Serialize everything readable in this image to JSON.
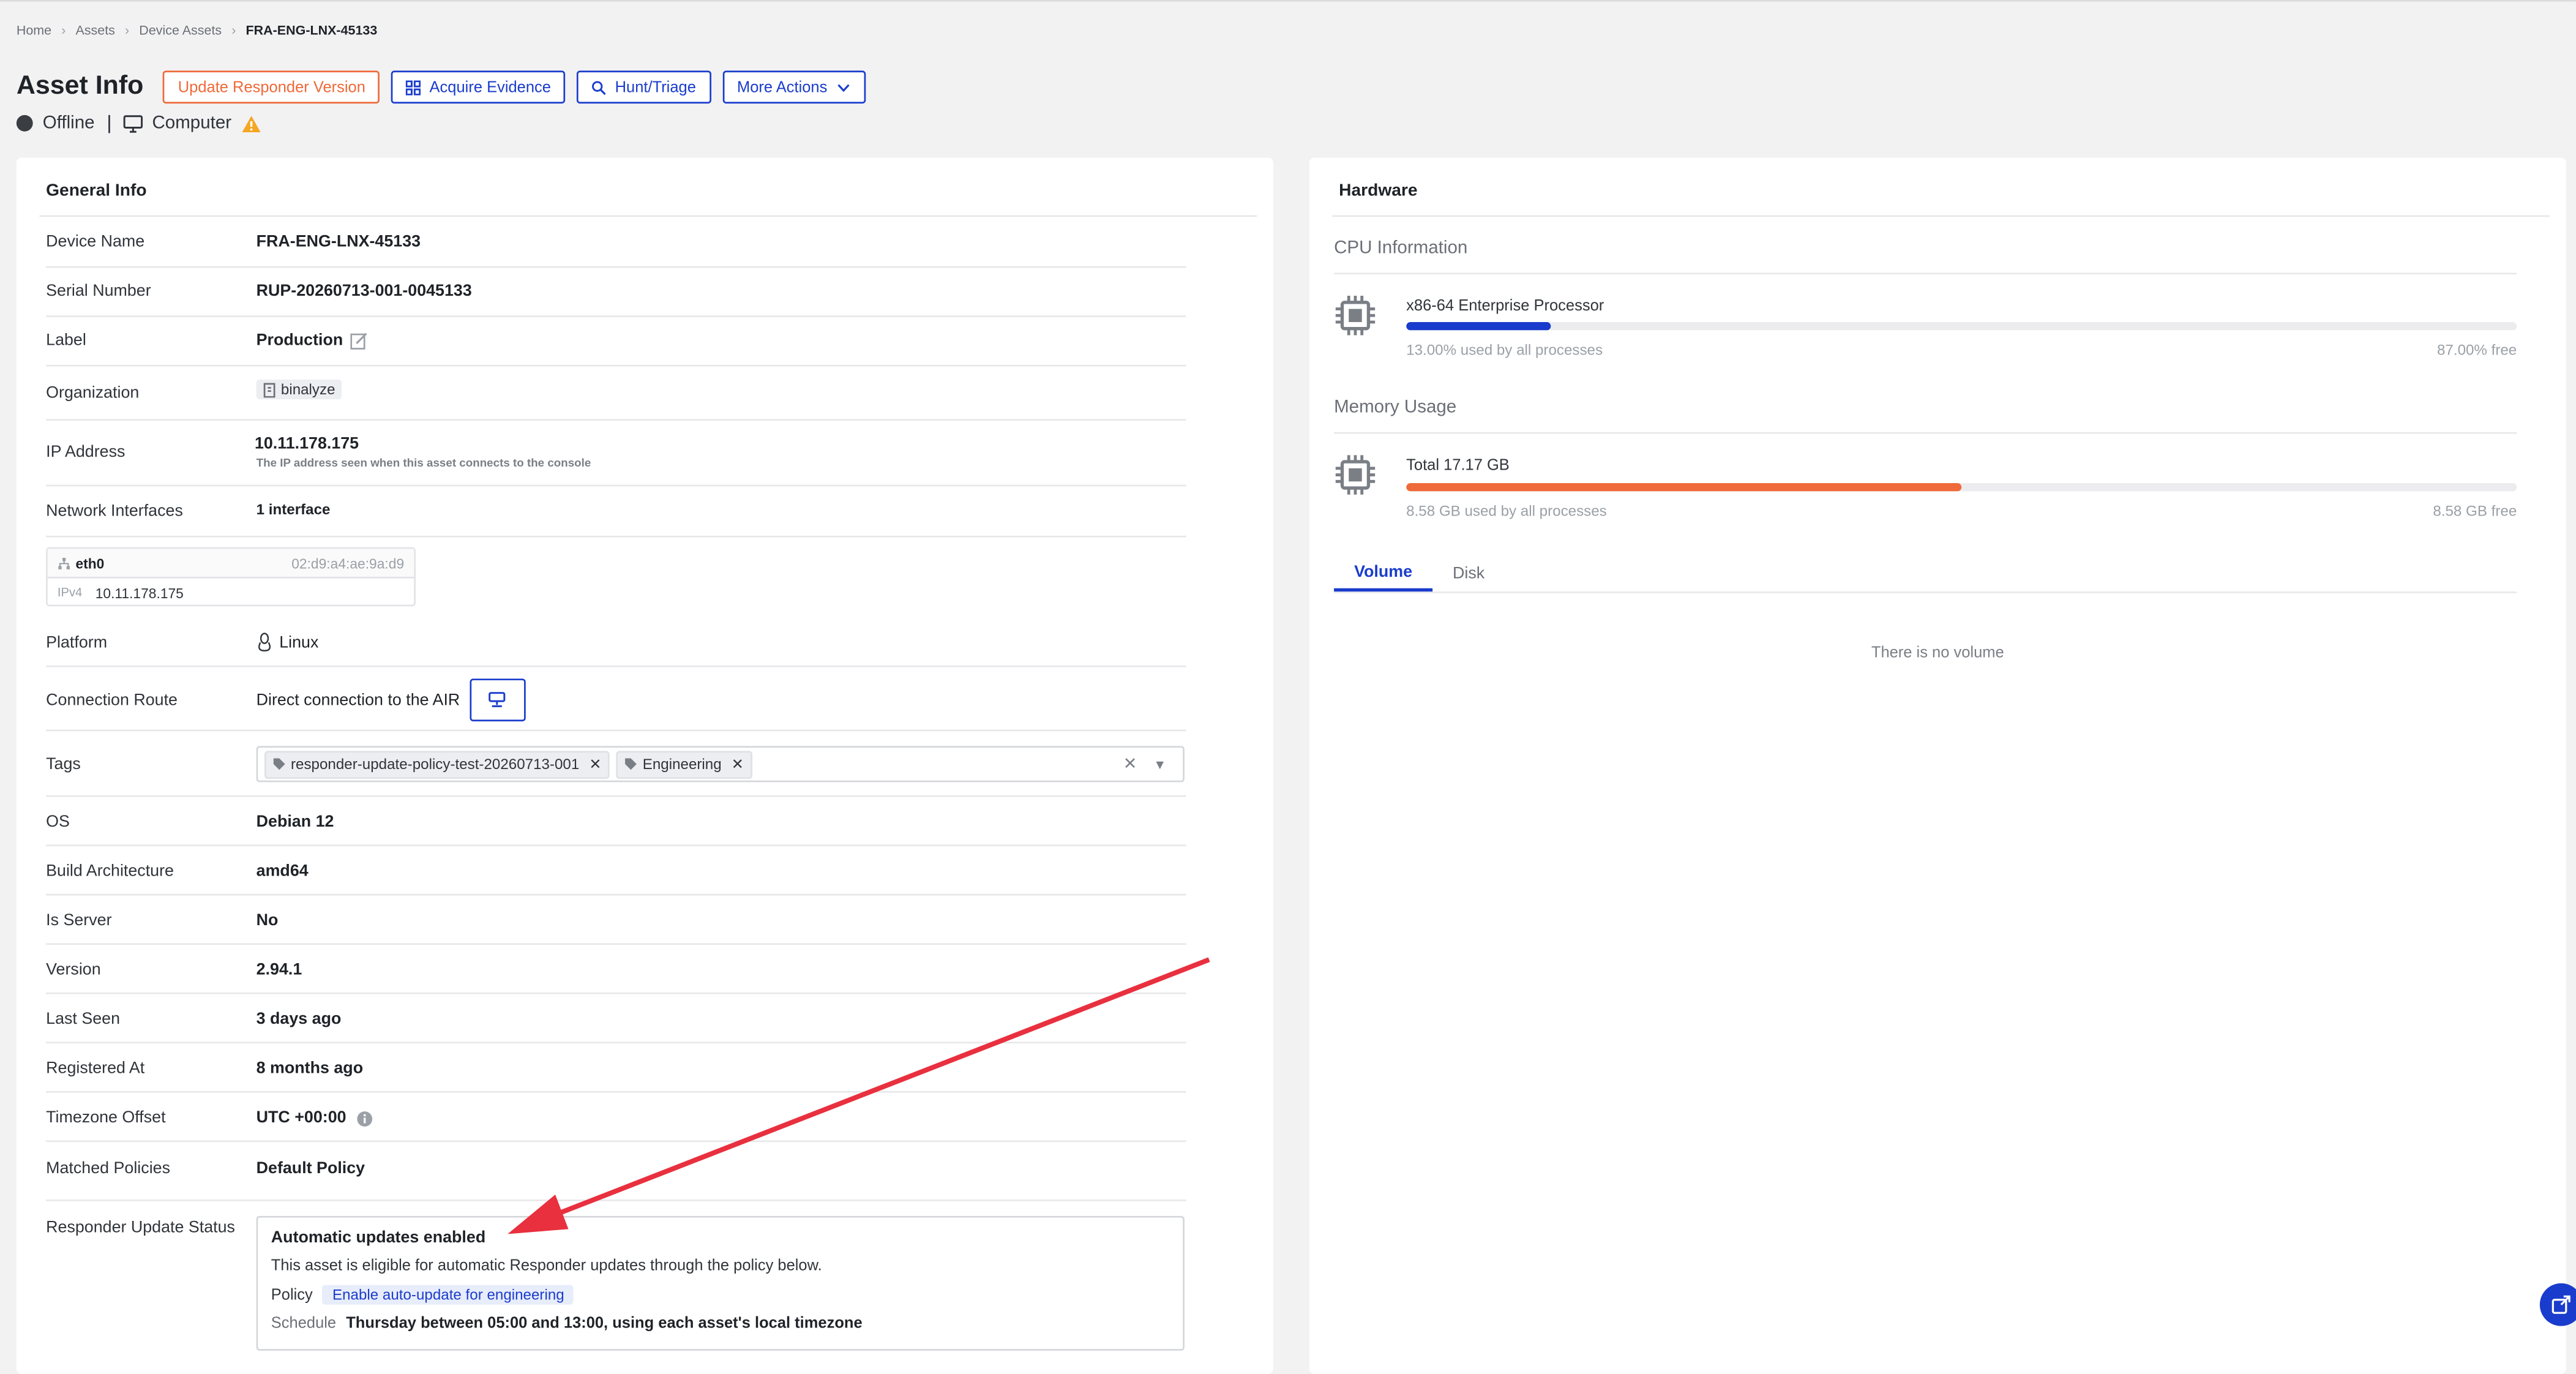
{
  "breadcrumb": [
    "Home",
    "Assets",
    "Device Assets",
    "FRA-ENG-LNX-45133"
  ],
  "header": {
    "title": "Asset Info",
    "buttons": {
      "update_responder": "Update Responder Version",
      "acquire": "Acquire Evidence",
      "hunt": "Hunt/Triage",
      "more": "More Actions"
    },
    "status": "Offline",
    "type": "Computer"
  },
  "general": {
    "title": "General Info",
    "device_name": {
      "label": "Device Name",
      "value": "FRA-ENG-LNX-45133"
    },
    "serial": {
      "label": "Serial Number",
      "value": "RUP-20260713-001-0045133"
    },
    "label": {
      "label": "Label",
      "value": "Production"
    },
    "organization": {
      "label": "Organization",
      "value": "binalyze"
    },
    "ip": {
      "label": "IP Address",
      "value": "10.11.178.175",
      "note": "The IP address seen when this asset connects to the console"
    },
    "network": {
      "label": "Network Interfaces",
      "value": "1 interface",
      "iface": {
        "name": "eth0",
        "mac": "02:d9:a4:ae:9a:d9",
        "family": "IPv4",
        "addr": "10.11.178.175"
      }
    },
    "platform": {
      "label": "Platform",
      "value": "Linux"
    },
    "route": {
      "label": "Connection Route",
      "value": "Direct connection to the AIR"
    },
    "tags": {
      "label": "Tags",
      "items": [
        "responder-update-policy-test-20260713-001",
        "Engineering"
      ]
    },
    "os": {
      "label": "OS",
      "value": "Debian 12"
    },
    "arch": {
      "label": "Build Architecture",
      "value": "amd64"
    },
    "server": {
      "label": "Is Server",
      "value": "No"
    },
    "version": {
      "label": "Version",
      "value": "2.94.1"
    },
    "last_seen": {
      "label": "Last Seen",
      "value": "3 days ago"
    },
    "registered": {
      "label": "Registered At",
      "value": "8 months ago"
    },
    "tz": {
      "label": "Timezone Offset",
      "value": "UTC +00:00"
    },
    "policies": {
      "label": "Matched Policies",
      "value": "Default Policy"
    },
    "update": {
      "label": "Responder Update Status",
      "heading": "Automatic updates enabled",
      "desc": "This asset is eligible for automatic Responder updates through the policy below.",
      "policy_label": "Policy",
      "policy_value": "Enable auto-update for engineering",
      "schedule_label": "Schedule",
      "schedule_value": "Thursday between 05:00 and 13:00, using each asset's local timezone"
    }
  },
  "hardware": {
    "title": "Hardware",
    "cpu": {
      "section": "CPU Information",
      "name": "x86-64 Enterprise Processor",
      "used_pct": 13,
      "used": "13.00% used by all processes",
      "free": "87.00% free"
    },
    "memory": {
      "section": "Memory Usage",
      "name": "Total 17.17 GB",
      "used_pct": 50,
      "used": "8.58 GB used by all processes",
      "free": "8.58 GB free"
    },
    "tabs": [
      "Volume",
      "Disk"
    ],
    "empty": "There is no volume"
  },
  "colors": {
    "accent": "#1a3ccc",
    "warning": "#f5a623",
    "memory_bar": "#ef6a3a",
    "annotation": "#e8303f"
  }
}
